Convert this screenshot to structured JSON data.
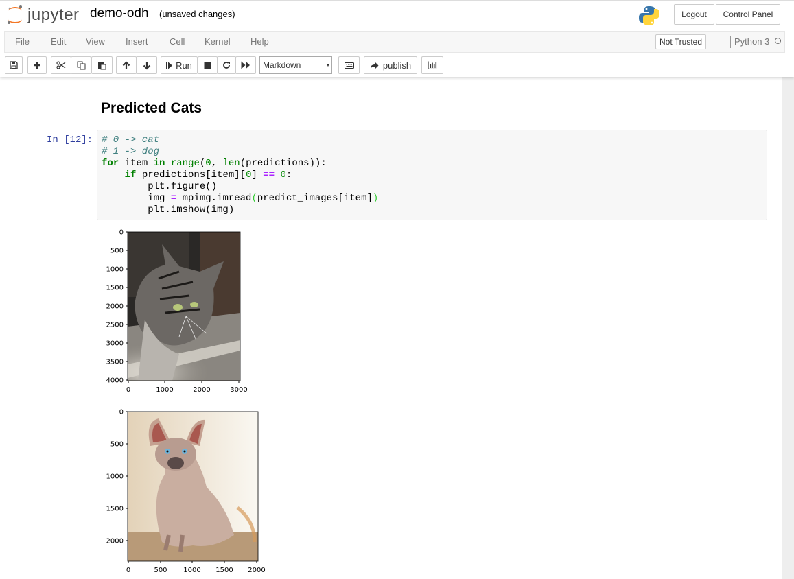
{
  "header": {
    "logo_text": "jupyter",
    "notebook_name": "demo-odh",
    "save_status": "(unsaved changes)",
    "logout_label": "Logout",
    "control_panel_label": "Control Panel"
  },
  "menubar": {
    "items": [
      "File",
      "Edit",
      "View",
      "Insert",
      "Cell",
      "Kernel",
      "Help"
    ],
    "trusted_label": "Not Trusted",
    "kernel_name": "Python 3"
  },
  "toolbar": {
    "run_label": "Run",
    "cell_type": "Markdown",
    "publish_label": "publish",
    "icons": [
      "save-icon",
      "plus-icon",
      "cut-icon",
      "copy-icon",
      "paste-icon",
      "arrow-up-icon",
      "arrow-down-icon",
      "step-forward-icon",
      "stop-icon",
      "refresh-icon",
      "fast-forward-icon",
      "keyboard-icon",
      "share-icon",
      "bar-chart-icon"
    ]
  },
  "notebook": {
    "markdown_heading": "Predicted Cats",
    "cell_prompt": "In [12]:",
    "code_lines": [
      "# 0 -> cat",
      "# 1 -> dog",
      "for item in range(0, len(predictions)):",
      "    if predictions[item][0] == 0:",
      "        plt.figure()",
      "        img = mpimg.imread(predict_images[item])",
      "        plt.imshow(img)"
    ]
  },
  "outputs": [
    {
      "image_desc": "tabby-cat-photo",
      "xticks": [
        "0",
        "1000",
        "2000",
        "3000"
      ],
      "yticks": [
        "0",
        "500",
        "1000",
        "1500",
        "2000",
        "2500",
        "3000",
        "3500",
        "4000"
      ],
      "colors": {
        "bg_dark": "#2a2826",
        "floor": "#8a8680",
        "light": "#d8d4cc"
      }
    },
    {
      "image_desc": "sphynx-cat-photo",
      "xticks": [
        "0",
        "500",
        "1000",
        "1500",
        "2000"
      ],
      "yticks": [
        "0",
        "500",
        "1000",
        "1500",
        "2000"
      ],
      "colors": {
        "bg": "#efe6d8",
        "body": "#c9aea0",
        "floor": "#b89a78"
      }
    }
  ]
}
